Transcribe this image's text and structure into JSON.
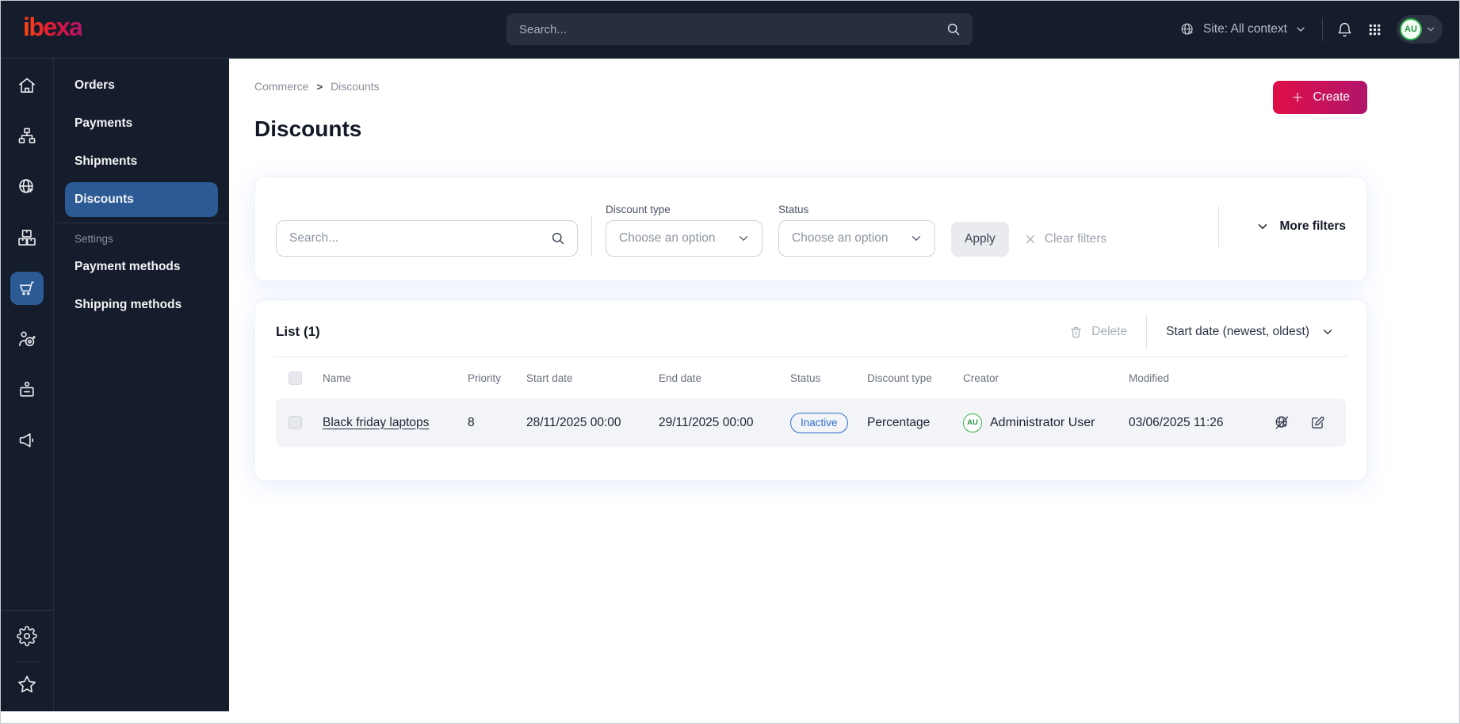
{
  "topbar": {
    "logo": "ibexa",
    "search_placeholder": "Search...",
    "site_context": "Site: All context",
    "user_initials": "AU"
  },
  "sidebar": {
    "rail_icons": [
      "home",
      "content-tree",
      "site",
      "product-catalog",
      "commerce-cart",
      "customer-target",
      "id-badge",
      "megaphone",
      "settings-gear",
      "bookmarks-star"
    ],
    "active_rail": "commerce-cart",
    "menu": {
      "items": [
        {
          "label": "Orders",
          "active": false
        },
        {
          "label": "Payments",
          "active": false
        },
        {
          "label": "Shipments",
          "active": false
        },
        {
          "label": "Discounts",
          "active": true
        }
      ],
      "section_label": "Settings",
      "settings_items": [
        {
          "label": "Payment methods"
        },
        {
          "label": "Shipping methods"
        }
      ]
    }
  },
  "breadcrumb": {
    "crumbs": [
      "Commerce",
      "Discounts"
    ],
    "separator": ">"
  },
  "page": {
    "title": "Discounts",
    "create_label": "Create"
  },
  "filters": {
    "search_placeholder": "Search...",
    "discount_type_label": "Discount type",
    "discount_type_value": "Choose an option",
    "status_label": "Status",
    "status_value": "Choose an option",
    "apply_label": "Apply",
    "clear_label": "Clear filters",
    "more_label": "More filters"
  },
  "list": {
    "title": "List (1)",
    "delete_label": "Delete",
    "sort_label": "Start date (newest, oldest)",
    "columns": [
      "Name",
      "Priority",
      "Start date",
      "End date",
      "Status",
      "Discount type",
      "Creator",
      "Modified"
    ],
    "rows": [
      {
        "name": "Black friday laptops",
        "priority": "8",
        "start_date": "28/11/2025 00:00",
        "end_date": "29/11/2025 00:00",
        "status": "Inactive",
        "discount_type": "Percentage",
        "creator_initials": "AU",
        "creator": "Administrator User",
        "modified": "03/06/2025 11:26"
      }
    ]
  },
  "icons": {
    "topbar": [
      "magnifier",
      "globe-cursor",
      "chevron-down",
      "bell",
      "app-grid"
    ],
    "filter_bar": [
      "magnifier",
      "chevron-down",
      "x-clear"
    ],
    "list_bar": [
      "trash",
      "chevron-down"
    ],
    "row_actions": [
      "preview-disabled",
      "edit"
    ]
  },
  "colors": {
    "topbar_bg": "#151c2b",
    "selected_blue": "#2b5a94",
    "accent_gradient_start": "#e00f47",
    "accent_gradient_end": "#b1156b",
    "status_badge_blue": "#2f6fd0",
    "avatar_green": "#2fae4c",
    "row_bg": "#f3f4f7"
  }
}
